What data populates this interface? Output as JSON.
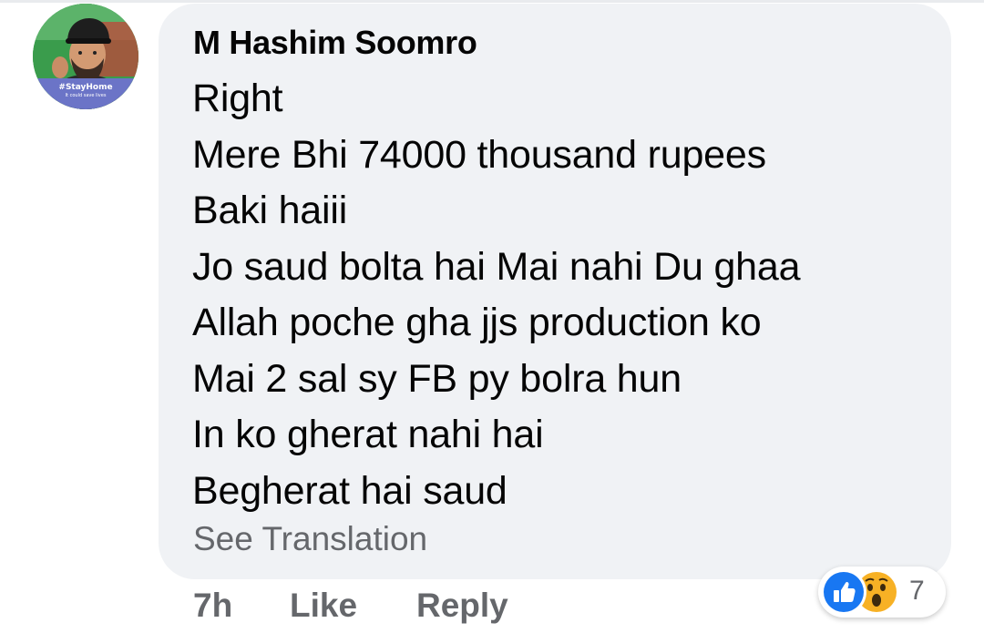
{
  "comment": {
    "author": "M Hashim Soomro",
    "avatar_frame": {
      "title": "#StayHome",
      "subtitle": "It could save lives"
    },
    "lines": [
      "Right",
      "Mere Bhi 74000 thousand rupees",
      "Baki haiii",
      "Jo saud bolta hai Mai nahi Du ghaa",
      "Allah poche gha jjs production ko",
      "Mai 2 sal sy FB py bolra hun",
      "In ko gherat nahi hai",
      "Begherat hai saud"
    ],
    "see_translation": "See Translation"
  },
  "actions": {
    "time": "7h",
    "like_label": "Like",
    "reply_label": "Reply"
  },
  "reactions": {
    "icons": [
      "like-icon",
      "wow-icon"
    ],
    "count": "7",
    "colors": {
      "like": "#1877f2",
      "wow": "#f7b125"
    }
  },
  "colors": {
    "bubble": "#f0f2f5",
    "text": "#050505",
    "secondary": "#65676b"
  }
}
